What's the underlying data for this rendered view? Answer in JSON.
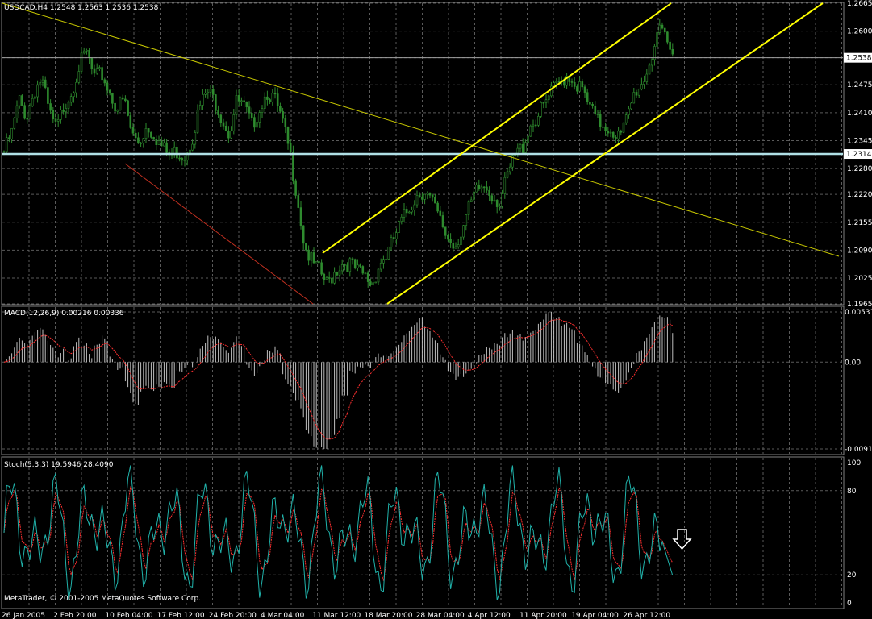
{
  "header": {
    "price_title": "USDCAD,H4  1.2548 1.2563 1.2536 1.2538",
    "macd_title": "MACD(12,26,9) 0.00216 0.00336",
    "stoch_title": "Stoch(5,3,3) 19.5946 28.4090",
    "copyright": "MetaTrader, © 2001-2005 MetaQuotes Software Corp."
  },
  "chart_data": [
    {
      "type": "candlestick",
      "name": "price",
      "title": "USDCAD,H4",
      "ohlc_last": {
        "open": 1.2548,
        "high": 1.2563,
        "low": 1.2536,
        "close": 1.2538
      },
      "ylim": [
        1.1965,
        1.2665
      ],
      "y_ticks": [
        "1.2665",
        "1.2600",
        "1.2538",
        "1.2475",
        "1.2410",
        "1.2345",
        "1.2314",
        "1.2280",
        "1.2220",
        "1.2155",
        "1.2090",
        "1.2025",
        "1.1965"
      ],
      "current_price": 1.2538,
      "horizontal_line": 1.2314,
      "grid": true,
      "close_series": [
        1.232,
        1.236,
        1.244,
        1.24,
        1.246,
        1.249,
        1.241,
        1.237,
        1.243,
        1.246,
        1.252,
        1.255,
        1.249,
        1.25,
        1.246,
        1.242,
        1.244,
        1.236,
        1.234,
        1.238,
        1.236,
        1.233,
        1.231,
        1.232,
        1.231,
        1.235,
        1.242,
        1.246,
        1.244,
        1.24,
        1.236,
        1.244,
        1.242,
        1.238,
        1.242,
        1.246,
        1.244,
        1.239,
        1.232,
        1.222,
        1.21,
        1.206,
        1.204,
        1.201,
        1.204,
        1.206,
        1.206,
        1.204,
        1.203,
        1.201,
        1.206,
        1.208,
        1.212,
        1.216,
        1.219,
        1.222,
        1.223,
        1.22,
        1.216,
        1.212,
        1.21,
        1.214,
        1.219,
        1.223,
        1.224,
        1.222,
        1.22,
        1.226,
        1.231,
        1.233,
        1.238,
        1.24,
        1.243,
        1.246,
        1.248,
        1.25,
        1.248,
        1.246,
        1.242,
        1.239,
        1.238,
        1.237,
        1.235,
        1.24,
        1.246,
        1.248,
        1.253,
        1.26,
        1.258,
        1.254
      ],
      "trend_lines": [
        {
          "from": [
            "26 Jan 2005",
            1.2665
          ],
          "to": [
            "26 Apr 12:00+",
            1.207
          ],
          "color": "#c8c800"
        },
        {
          "from": [
            "10 Feb 04:00",
            1.229
          ],
          "to": [
            "11 Mar 12:00",
            1.1965
          ],
          "color": "#c03020"
        },
        {
          "from": [
            "11 Mar 12:00",
            1.208
          ],
          "to": [
            "26 Apr 12:00",
            1.2665
          ],
          "color": "#ffff00"
        },
        {
          "from": [
            "18 Mar 20:00",
            1.1965
          ],
          "to": [
            "26 Apr 12:00+",
            1.2665
          ],
          "color": "#ffff00"
        }
      ],
      "x_labels": [
        "26 Jan 2005",
        "2 Feb 20:00",
        "10 Feb 04:00",
        "17 Feb 12:00",
        "24 Feb 20:00",
        "4 Mar 04:00",
        "11 Mar 12:00",
        "18 Mar 20:00",
        "28 Mar 04:00",
        "4 Apr 12:00",
        "11 Apr 20:00",
        "19 Apr 04:00",
        "26 Apr 12:00"
      ]
    },
    {
      "type": "histogram",
      "name": "MACD(12,26,9)",
      "values_current": [
        0.00216,
        0.00336
      ],
      "ylim": [
        -0.00918,
        0.00531
      ],
      "y_ticks": [
        "0.00531",
        "0.00",
        "-0.00918"
      ],
      "grid": true
    },
    {
      "type": "line",
      "name": "Stoch(5,3,3)",
      "values_current": [
        19.5946,
        28.409
      ],
      "ylim": [
        0,
        100
      ],
      "y_ticks": [
        "100",
        "80",
        "20",
        "0"
      ],
      "levels": [
        80,
        20
      ],
      "grid": true
    }
  ],
  "colors": {
    "background": "#000000",
    "grid": "#5a5a5a",
    "candle": "#2e8b2e",
    "macd_hist": "#c0c0c0",
    "macd_signal": "#ff3030",
    "stoch_main": "#20b2aa",
    "stoch_signal": "#ff3030",
    "hline": "#b0e0e6"
  },
  "icons": {
    "arrow": "down-arrow-icon"
  }
}
